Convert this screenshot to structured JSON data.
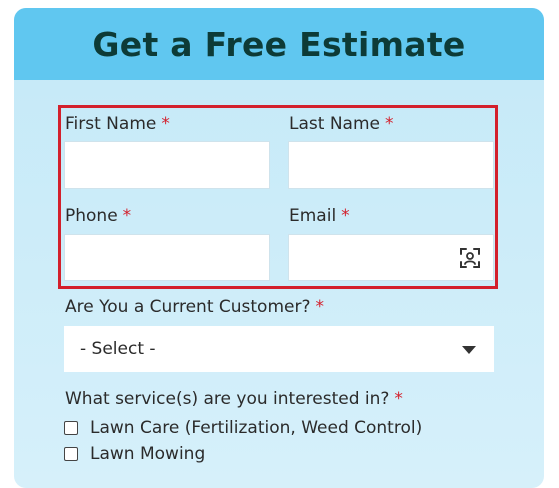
{
  "form": {
    "title": "Get a Free Estimate",
    "required_mark": "*",
    "first_name_label": "First Name",
    "last_name_label": "Last Name",
    "phone_label": "Phone",
    "email_label": "Email",
    "customer_label": "Are You a Current Customer?",
    "customer_select_value": "- Select -",
    "services_label": "What service(s) are you interested in?",
    "services": [
      "Lawn Care (Fertilization, Weed Control)",
      "Lawn Mowing"
    ]
  },
  "colors": {
    "header": "#60c7f0",
    "body": "#c4e9f8",
    "title": "#0d3b37",
    "required": "#d3202c",
    "highlight": "#d3202c"
  },
  "icons": {
    "email_field_icon": "contact-card-icon",
    "select_caret": "caret-down-icon"
  }
}
